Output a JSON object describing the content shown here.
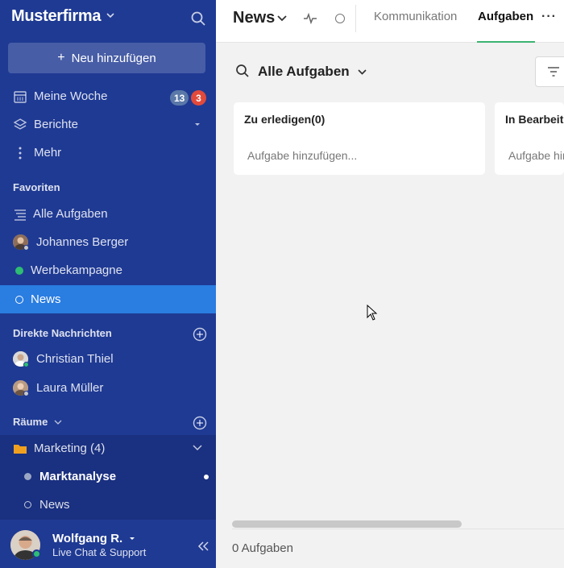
{
  "sidebar": {
    "org_name": "Musterfirma",
    "add_button": "Neu hinzufügen",
    "nav": [
      {
        "label": "Meine Woche",
        "icon": "calendar-icon",
        "badge_grey": "13",
        "badge_red": "3"
      },
      {
        "label": "Berichte",
        "icon": "layers-icon"
      },
      {
        "label": "Mehr",
        "icon": "more-vertical-icon"
      }
    ],
    "favorites_title": "Favoriten",
    "favorites": [
      {
        "label": "Alle Aufgaben",
        "icon": "list-icon"
      },
      {
        "label": "Johannes Berger",
        "icon": "avatar"
      },
      {
        "label": "Werbekampagne",
        "icon": "green-dot-icon"
      },
      {
        "label": "News",
        "icon": "circle-icon",
        "active": true
      }
    ],
    "dm_title": "Direkte Nachrichten",
    "direct_messages": [
      {
        "label": "Christian Thiel"
      },
      {
        "label": "Laura Müller"
      }
    ],
    "rooms_title": "Räume",
    "rooms": [
      {
        "label": "Marketing (4)",
        "icon": "folder-icon"
      },
      {
        "label": "Marktanalyse",
        "unread": true
      },
      {
        "label": "News"
      }
    ],
    "user": {
      "name": "Wolfgang R.",
      "status": "Live Chat & Support"
    }
  },
  "topbar": {
    "title": "News",
    "tabs": [
      "Kommunikation",
      "Aufgaben"
    ],
    "active_tab": "Aufgaben"
  },
  "main": {
    "filter_title": "Alle Aufgaben",
    "columns": [
      {
        "title": "Zu erledigen(0)",
        "placeholder": "Aufgabe hinzufügen..."
      },
      {
        "title": "In Bearbeitung",
        "placeholder": "Aufgabe hinzufügen..."
      }
    ],
    "task_count": "0 Aufgaben"
  },
  "colors": {
    "sidebar_bg": "#1f3a93",
    "active_item": "#2a7de1",
    "tab_underline": "#3cb371",
    "badge_red": "#e24a3b"
  }
}
